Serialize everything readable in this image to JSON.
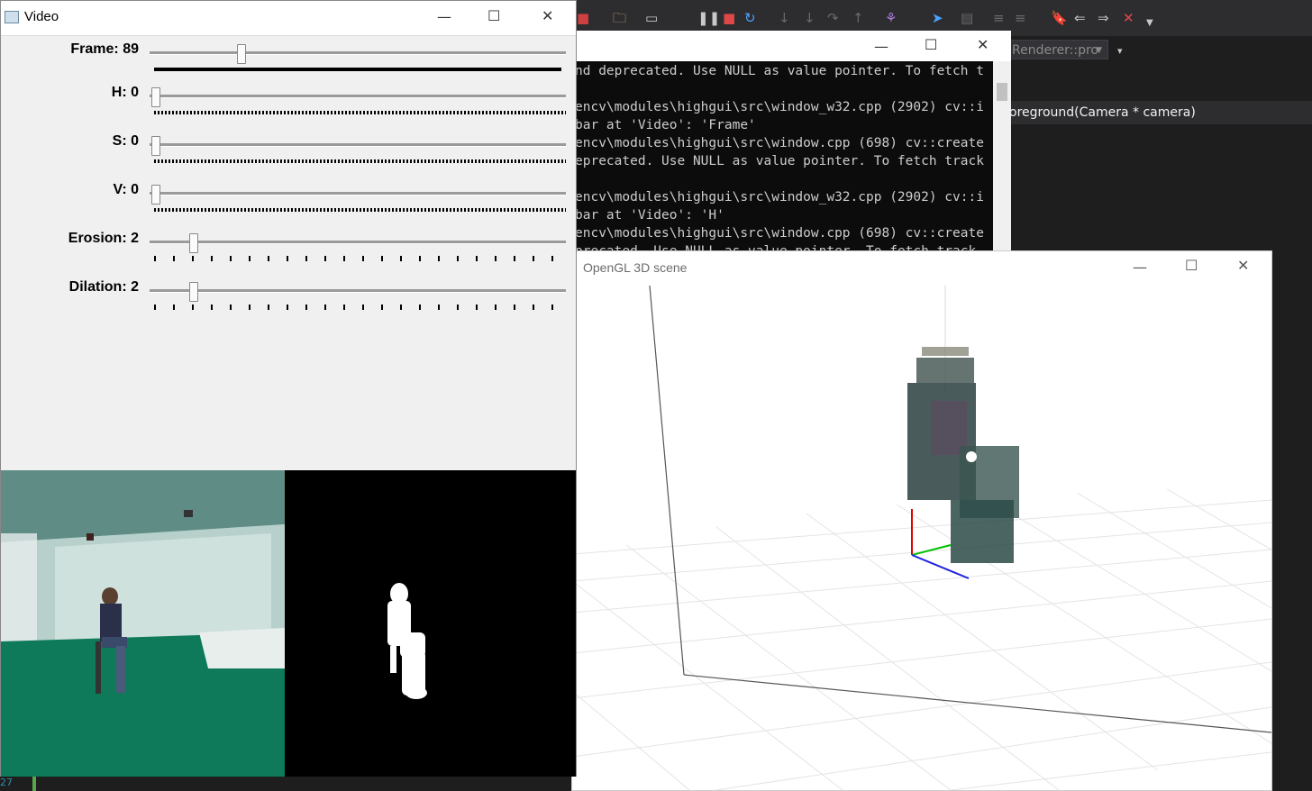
{
  "ide": {
    "config_dropdown": "Renderer::pro",
    "function_signature": "oreground(Camera * camera)",
    "line_number": "27"
  },
  "console": {
    "lines": [
      "nd deprecated. Use NULL as value pointer. To fetch t",
      "",
      "encv\\modules\\highgui\\src\\window_w32.cpp (2902) cv::i",
      "bar at 'Video': 'Frame'",
      "encv\\modules\\highgui\\src\\window.cpp (698) cv::create",
      "eprecated. Use NULL as value pointer. To fetch track",
      "",
      "encv\\modules\\highgui\\src\\window_w32.cpp (2902) cv::i",
      "bar at 'Video': 'H'",
      "encv\\modules\\highgui\\src\\window.cpp (698) cv::create",
      "precated. Use NULL as value pointer. To fetch track"
    ]
  },
  "video_window": {
    "title": "Video",
    "trackbars": [
      {
        "label": "Frame: 89",
        "value": 89
      },
      {
        "label": "H: 0",
        "value": 0
      },
      {
        "label": "S: 0",
        "value": 0
      },
      {
        "label": "V: 0",
        "value": 0
      },
      {
        "label": "Erosion: 2",
        "value": 2
      },
      {
        "label": "Dilation: 2",
        "value": 2
      }
    ]
  },
  "gl_window": {
    "title": "OpenGL 3D scene"
  },
  "colors": {
    "ide_bg": "#1e1e1e",
    "console_bg": "#0c0c0c",
    "floor_green": "#0e7a5a",
    "axis_x": "#e00000",
    "axis_y": "#00c000",
    "axis_z": "#2020e0"
  }
}
